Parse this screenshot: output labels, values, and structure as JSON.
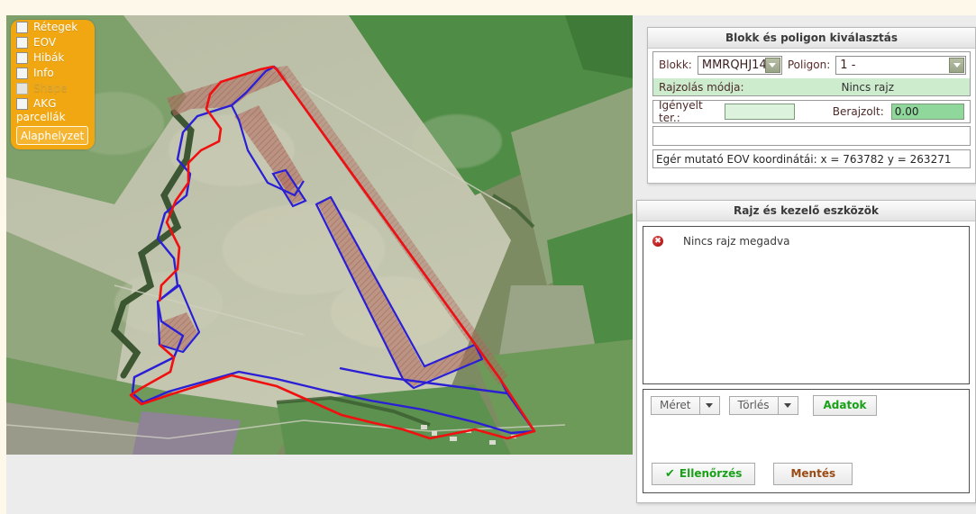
{
  "app": {
    "background_color": "#fdf8ea",
    "content_bg": "#ececec"
  },
  "layers_panel": {
    "accent_color": "#f0a712",
    "items": [
      {
        "label": "Rétegek",
        "checked": false,
        "disabled": false
      },
      {
        "label": "EOV",
        "checked": false,
        "disabled": false
      },
      {
        "label": "Hibák",
        "checked": false,
        "disabled": false
      },
      {
        "label": "Info",
        "checked": false,
        "disabled": false
      },
      {
        "label": "Shape",
        "checked": false,
        "disabled": true
      },
      {
        "label": "AKG",
        "checked": false,
        "disabled": false
      }
    ],
    "akg_second_line": "parcellák",
    "reset_button": "Alaphelyzet"
  },
  "panel_select": {
    "title": "Blokk és poligon kiválasztás",
    "blokk_label": "Blokk:",
    "blokk_value": "MMRQHJ14",
    "poligon_label": "Poligon:",
    "poligon_value": "1 -",
    "draw_mode_label": "Rajzolás módja:",
    "draw_mode_value": "Nincs rajz",
    "requested_label": "Igényelt ter.:",
    "requested_value": "",
    "drawn_label": "Berajzolt:",
    "drawn_value": "0.00",
    "coord_text": "Egér mutató EOV koordinátái: x = 763782   y = 263271"
  },
  "panel_tools": {
    "title": "Rajz és kezelő eszközök",
    "message": "Nincs rajz megadva",
    "error_icon": "error-icon",
    "toolbar": {
      "meret_label": "Méret",
      "torles_label": "Törlés",
      "adatok_label": "Adatok"
    },
    "footer": {
      "ellenorzes_label": "Ellenőrzés",
      "mentes_label": "Mentés",
      "check_glyph": "✔"
    }
  },
  "map": {
    "name": "satellite-parcel-map",
    "overlay_colors": {
      "block_outline": "#2b1fd6",
      "parcel_outline": "#f01010",
      "hatch_fill": "#b4645a"
    }
  }
}
